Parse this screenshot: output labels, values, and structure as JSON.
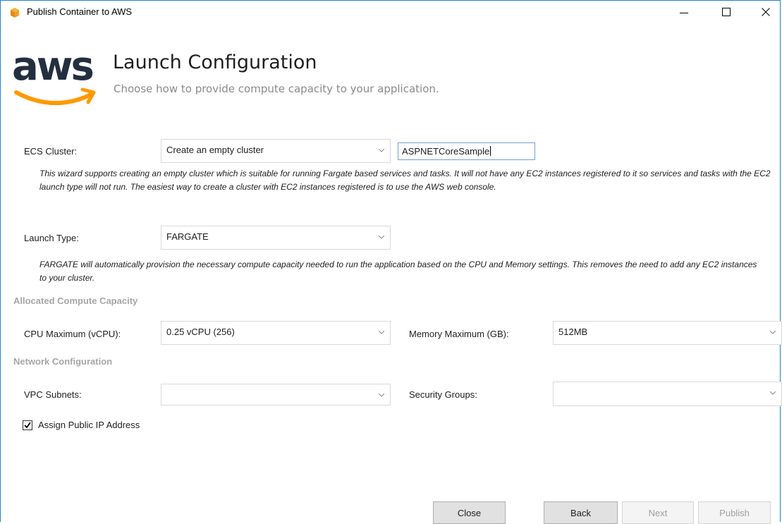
{
  "window": {
    "title": "Publish Container to AWS"
  },
  "header": {
    "logo_text": "aws",
    "title": "Launch Configuration",
    "subtitle": "Choose how to provide compute capacity to your application."
  },
  "ecs_cluster": {
    "label": "ECS Cluster:",
    "selected": "Create an empty cluster",
    "name_value": "ASPNETCoreSample",
    "description": "This wizard supports creating an empty cluster which is suitable for running Fargate based services and tasks. It will not have any EC2 instances registered to it so services and tasks with the EC2 launch type will not run. The easiest way to create a cluster with EC2 instances registered is to use the AWS web console."
  },
  "launch_type": {
    "label": "Launch Type:",
    "selected": "FARGATE",
    "description": "FARGATE will automatically provision the necessary compute capacity needed to run the application based on the CPU and Memory settings. This removes the need to add any EC2 instances to your cluster."
  },
  "compute": {
    "section_title": "Allocated Compute Capacity",
    "cpu_label": "CPU Maximum (vCPU):",
    "cpu_value": "0.25 vCPU (256)",
    "memory_label": "Memory Maximum (GB):",
    "memory_value": "512MB"
  },
  "network": {
    "section_title": "Network Configuration",
    "subnets_label": "VPC Subnets:",
    "subnets_value": "",
    "security_groups_label": "Security Groups:",
    "security_groups_value": "",
    "assign_public_ip_label": "Assign Public IP Address",
    "assign_public_ip_checked": true
  },
  "footer": {
    "close_label": "Close",
    "back_label": "Back",
    "next_label": "Next",
    "publish_label": "Publish"
  },
  "colors": {
    "aws_orange": "#ff9900",
    "aws_text": "#232f3e",
    "accent_blue": "#1883d7"
  }
}
